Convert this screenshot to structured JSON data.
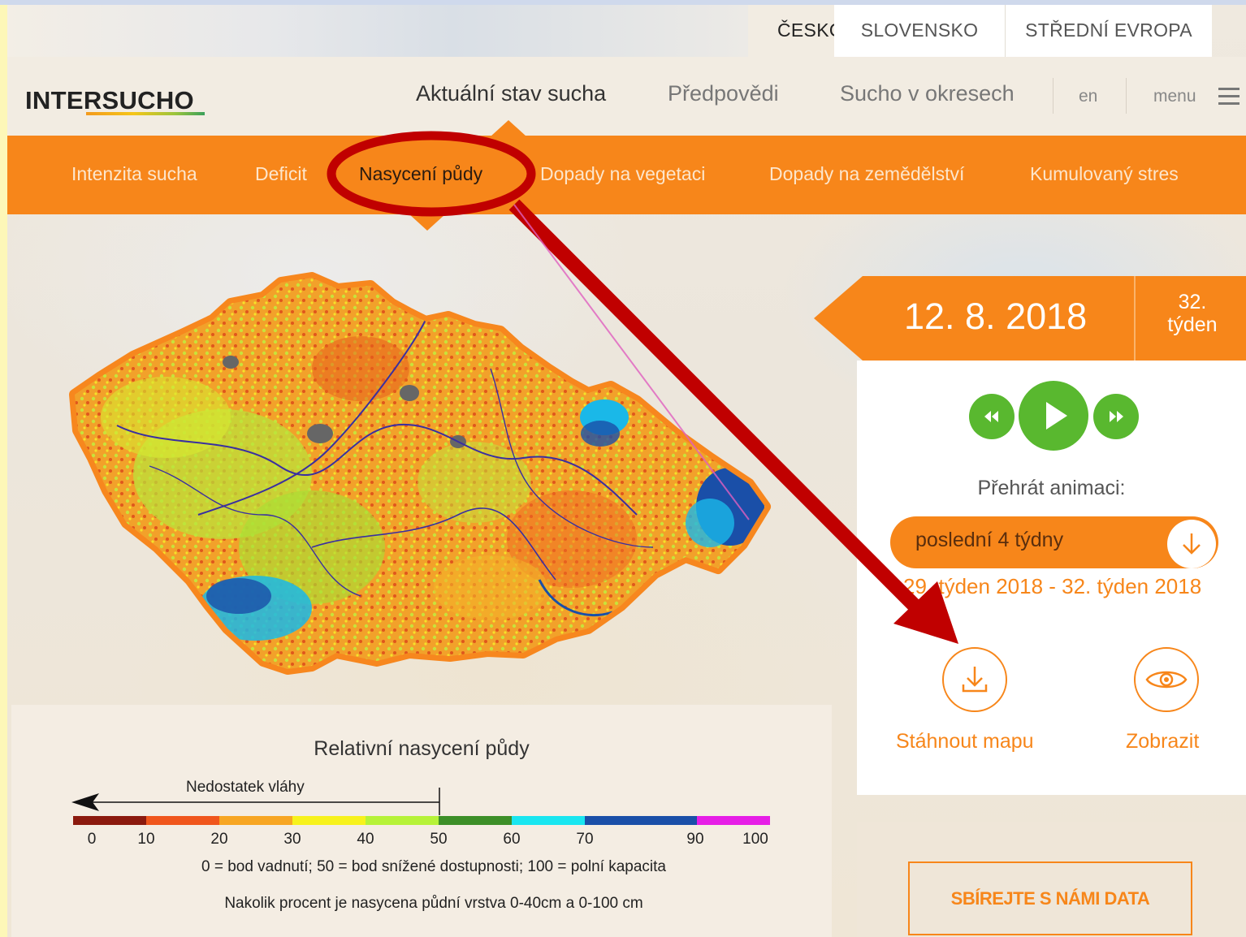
{
  "countries": [
    "ČESKO",
    "SLOVENSKO",
    "STŘEDNÍ EVROPA"
  ],
  "logo": {
    "part1": "INTER",
    "part2": "SUCHO"
  },
  "mainnav": {
    "items": [
      "Aktuální stav sucha",
      "Předpovědi",
      "Sucho v okresech"
    ],
    "lang": "en",
    "menu": "menu"
  },
  "subnav": [
    "Intenzita sucha",
    "Deficit",
    "Nasycení půdy",
    "Dopady na vegetaci",
    "Dopady na zemědělství",
    "Kumulovaný stres"
  ],
  "date": {
    "value": "12. 8. 2018",
    "week_num": "32.",
    "week_word": "týden"
  },
  "player": {
    "label": "Přehrát animaci:",
    "select_value": "poslední 4 týdny",
    "range": "29. týden 2018 - 32. týden 2018"
  },
  "actions": {
    "download": "Stáhnout mapu",
    "view": "Zobrazit"
  },
  "cta": "SBÍREJTE S NÁMI DATA",
  "legend": {
    "title": "Relativní nasycení půdy",
    "arrow_label": "Nedostatek vláhy",
    "ticks": [
      "0",
      "10",
      "20",
      "30",
      "40",
      "50",
      "60",
      "70",
      "90",
      "100"
    ],
    "colors": [
      "#8b1a0e",
      "#f0561c",
      "#f7a623",
      "#f7f21c",
      "#b6f238",
      "#3d8f28",
      "#19e6f0",
      "#1a4fa8",
      "#e61ee6"
    ],
    "note1": "0 = bod vadnutí; 50 = bod snížené dostupnosti; 100 = polní kapacita",
    "note2": "Nakolik procent je nasycena půdní vrstva 0-40cm a 0-100 cm"
  },
  "colors": {
    "accent": "#f7861a",
    "play": "#59b82f",
    "annotation": "#c00000"
  }
}
